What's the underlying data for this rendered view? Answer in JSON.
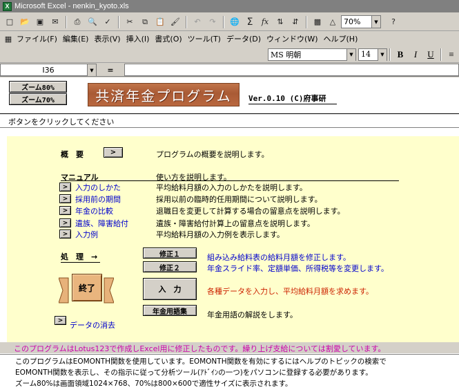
{
  "window": {
    "title": "Microsoft Excel - nenkin_kyoto.xls"
  },
  "toolbar": {
    "zoom": "70%"
  },
  "menu": [
    "ファイル(F)",
    "編集(E)",
    "表示(V)",
    "挿入(I)",
    "書式(O)",
    "ツール(T)",
    "データ(D)",
    "ウィンドウ(W)",
    "ヘルプ(H)"
  ],
  "format": {
    "font": "MS 明朝",
    "size": "14",
    "bold": "B",
    "italic": "I",
    "underline": "U"
  },
  "formula": {
    "cell": "I36",
    "equals": "="
  },
  "sheet": {
    "zoom80": "ズーム80%",
    "zoom70": "ズーム70%",
    "banner": "共済年金プログラム",
    "version": "Ver.0.10 (C)府事研",
    "prompt": "ボタンをクリックしてください",
    "overview_label": "概　要",
    "overview_desc": "プログラムの概要を説明します。",
    "manual_label": "マニュアル",
    "manual_desc": "使い方を説明します。",
    "manual_items": [
      {
        "label": "入力のしかた",
        "desc": "平均給料月額の入力のしかたを説明します。"
      },
      {
        "label": "採用前の期間",
        "desc": "採用以前の臨時的任用期間について説明します。"
      },
      {
        "label": "年金の比較",
        "desc": "退職日を変更して計算する場合の留意点を説明します。"
      },
      {
        "label": "遺族、障害給付",
        "desc": "遺族・障害給付計算上の留意点を説明します。"
      },
      {
        "label": "入力例",
        "desc": "平均給料月額の入力例を表示します。"
      }
    ],
    "process_label": "処　理　→",
    "end_label": "終了",
    "fix1": "修正１",
    "fix1_desc": "組み込み給料表の給料月額を修正します。",
    "fix2": "修正２",
    "fix2_desc": "年金スライド率、定額単価、所得税等を変更します。",
    "input": "入　力",
    "input_desc": "各種データを入力し、平均給料月額を求めます。",
    "glossary": "年金用語集",
    "glossary_desc": "年金用語の解説をします。",
    "clear_label": "データの消去",
    "arrow": ">",
    "notice": "このプログラムはLotus123で作成しExcel用に修正したものです。繰り上げ支給については割愛しています。",
    "desc1": "このプログラムはEOMONTH関数を使用しています。EOMONTH関数を有効にするにはヘルプのトピックの検索で",
    "desc2": "EOMONTH関数を表示し、その指示に従って分析ツール(ｱﾄﾞｲﾝの一つ)をパソコンに登録する必要があります。",
    "desc3": "ズーム80%は画面領域1024×768、70%は800×600で適性サイズに表示されます。"
  }
}
